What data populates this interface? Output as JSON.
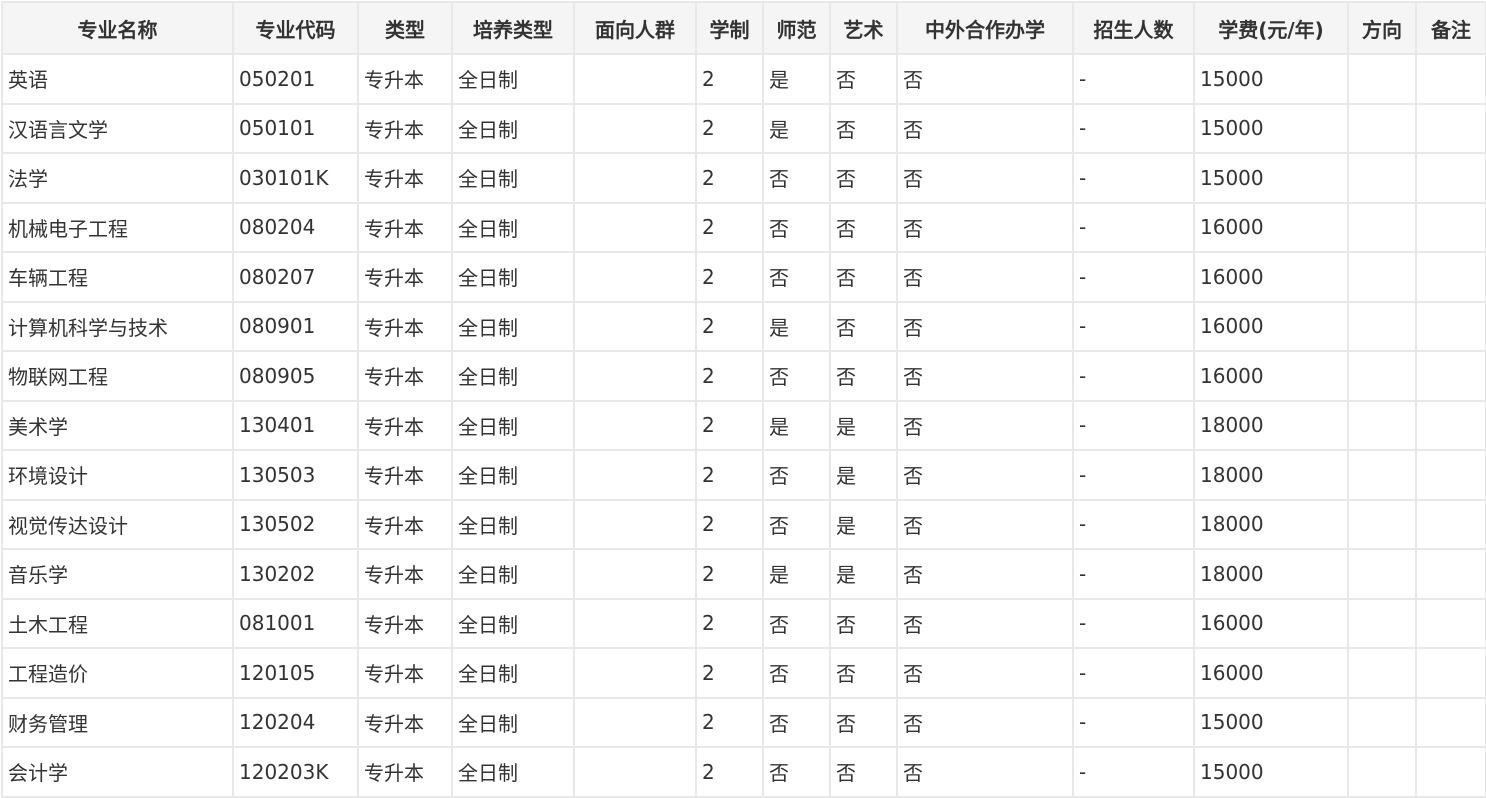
{
  "table": {
    "headers": [
      "专业名称",
      "专业代码",
      "类型",
      "培养类型",
      "面向人群",
      "学制",
      "师范",
      "艺术",
      "中外合作办学",
      "招生人数",
      "学费(元/年)",
      "方向",
      "备注"
    ],
    "rows": [
      [
        "英语",
        "050201",
        "专升本",
        "全日制",
        "",
        "2",
        "是",
        "否",
        "否",
        "-",
        "15000",
        "",
        ""
      ],
      [
        "汉语言文学",
        "050101",
        "专升本",
        "全日制",
        "",
        "2",
        "是",
        "否",
        "否",
        "-",
        "15000",
        "",
        ""
      ],
      [
        "法学",
        "030101K",
        "专升本",
        "全日制",
        "",
        "2",
        "否",
        "否",
        "否",
        "-",
        "15000",
        "",
        ""
      ],
      [
        "机械电子工程",
        "080204",
        "专升本",
        "全日制",
        "",
        "2",
        "否",
        "否",
        "否",
        "-",
        "16000",
        "",
        ""
      ],
      [
        "车辆工程",
        "080207",
        "专升本",
        "全日制",
        "",
        "2",
        "否",
        "否",
        "否",
        "-",
        "16000",
        "",
        ""
      ],
      [
        "计算机科学与技术",
        "080901",
        "专升本",
        "全日制",
        "",
        "2",
        "是",
        "否",
        "否",
        "-",
        "16000",
        "",
        ""
      ],
      [
        "物联网工程",
        "080905",
        "专升本",
        "全日制",
        "",
        "2",
        "否",
        "否",
        "否",
        "-",
        "16000",
        "",
        ""
      ],
      [
        "美术学",
        "130401",
        "专升本",
        "全日制",
        "",
        "2",
        "是",
        "是",
        "否",
        "-",
        "18000",
        "",
        ""
      ],
      [
        "环境设计",
        "130503",
        "专升本",
        "全日制",
        "",
        "2",
        "否",
        "是",
        "否",
        "-",
        "18000",
        "",
        ""
      ],
      [
        "视觉传达设计",
        "130502",
        "专升本",
        "全日制",
        "",
        "2",
        "否",
        "是",
        "否",
        "-",
        "18000",
        "",
        ""
      ],
      [
        "音乐学",
        "130202",
        "专升本",
        "全日制",
        "",
        "2",
        "是",
        "是",
        "否",
        "-",
        "18000",
        "",
        ""
      ],
      [
        "土木工程",
        "081001",
        "专升本",
        "全日制",
        "",
        "2",
        "否",
        "否",
        "否",
        "-",
        "16000",
        "",
        ""
      ],
      [
        "工程造价",
        "120105",
        "专升本",
        "全日制",
        "",
        "2",
        "否",
        "否",
        "否",
        "-",
        "16000",
        "",
        ""
      ],
      [
        "财务管理",
        "120204",
        "专升本",
        "全日制",
        "",
        "2",
        "否",
        "否",
        "否",
        "-",
        "15000",
        "",
        ""
      ],
      [
        "会计学",
        "120203K",
        "专升本",
        "全日制",
        "",
        "2",
        "否",
        "否",
        "否",
        "-",
        "15000",
        "",
        ""
      ]
    ]
  }
}
